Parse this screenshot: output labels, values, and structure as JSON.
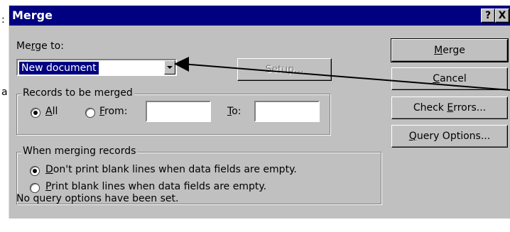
{
  "background": {
    "left_glyph_1": ":",
    "left_glyph_2": "a"
  },
  "dialog": {
    "title": "Merge",
    "help_button": "?",
    "close_button": "X"
  },
  "merge_to": {
    "label_prefix": "Me",
    "label_accel": "r",
    "label_suffix": "ge to:",
    "selected_value": "New document"
  },
  "setup_button": {
    "label": "Setup..."
  },
  "records_group": {
    "title": "Records to be merged",
    "all_accel": "A",
    "all_rest": "ll",
    "from_accel": "F",
    "from_rest": "rom:",
    "to_accel": "T",
    "to_rest": "o:",
    "from_value": "",
    "to_value": ""
  },
  "when_merging_group": {
    "title": "When merging records",
    "option1_accel": "D",
    "option1_rest": "on't print blank lines when data fields are empty.",
    "option2_accel": "P",
    "option2_rest": "rint blank lines when data fields are empty."
  },
  "status_text": "No query options have been set.",
  "buttons": {
    "merge_accel": "M",
    "merge_rest": "erge",
    "cancel_accel": "C",
    "cancel_rest": "ancel",
    "check_prefix": "Check ",
    "check_accel": "E",
    "check_rest": "rrors...",
    "query_accel": "Q",
    "query_rest": "uery Options..."
  },
  "colors": {
    "titlebar": "#000080",
    "face": "#c0c0c0",
    "selection": "#000080"
  }
}
